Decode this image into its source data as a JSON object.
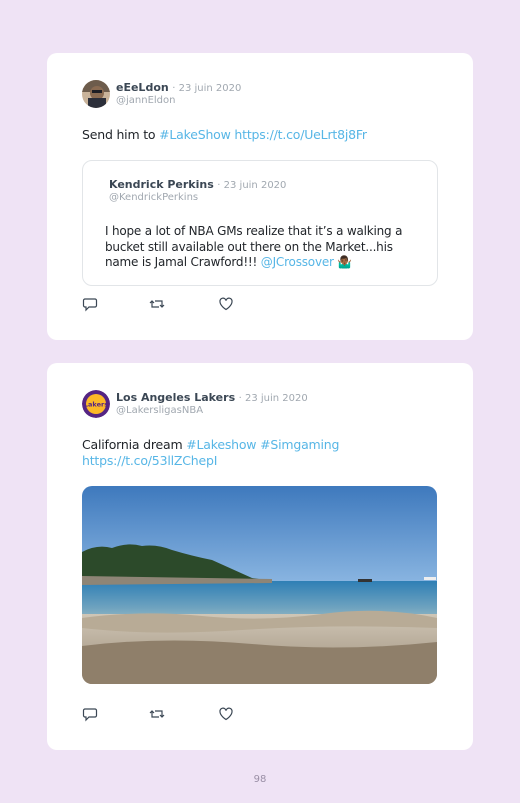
{
  "tweets": [
    {
      "author": "eEeLdon",
      "date": "· 23 juin 2020",
      "handle": "@jannEldon",
      "text_plain": "Send him to ",
      "hashtag": "#LakeShow",
      "link": "https://t.co/UeLrt8j8Fr",
      "quoted": {
        "author": "Kendrick Perkins",
        "date": "· 23 juin 2020",
        "handle": "@KendrickPerkins",
        "text": "I hope a lot of NBA GMs realize that it’s a walking a bucket still available out there on the Market...his name is Jamal Crawford!!! ",
        "mention": "@JCrossover",
        "emoji": "🤷🏾‍♂️"
      }
    },
    {
      "author": "Los Angeles Lakers",
      "date": "· 23 juin 2020",
      "handle": "@LakersligasNBA",
      "text_plain": "California dream ",
      "hashtag1": "#Lakeshow",
      "hashtag2": "#Simgaming",
      "link": "https://t.co/53llZChepI",
      "avatar_text": "Lakers"
    }
  ],
  "icons": [
    "reply-icon",
    "retweet-icon",
    "like-icon"
  ],
  "page_number": "98",
  "colors": {
    "background": "#efe3f5",
    "link": "#57b6e6",
    "muted": "#a1a8b0"
  }
}
